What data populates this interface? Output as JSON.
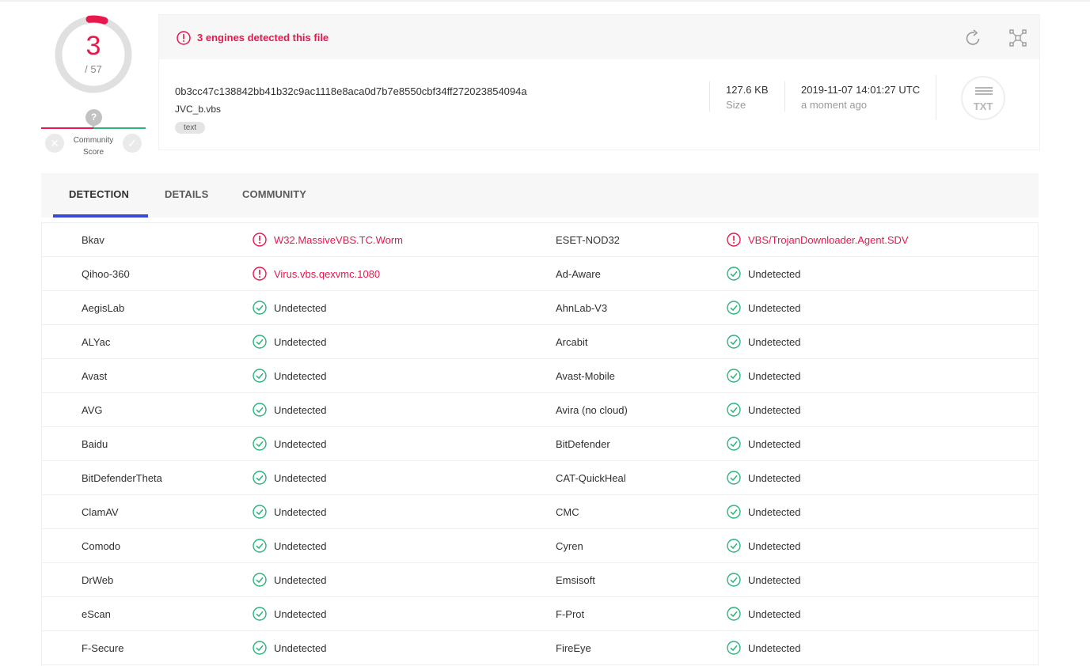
{
  "score": {
    "detected": "3",
    "total": "/ 57",
    "community_label_1": "Community",
    "community_label_2": "Score",
    "unknown_glyph": "?"
  },
  "file": {
    "alert_text": "3 engines detected this file",
    "hash": "0b3cc47c138842bb41b32c9ac1118e8aca0d7b7e8550cbf34ff272023854094a",
    "name": "JVC_b.vbs",
    "tag": "text",
    "size_value": "127.6 KB",
    "size_label": "Size",
    "date_value": "2019-11-07 14:01:27 UTC",
    "date_label": "a moment ago",
    "type_label": "TXT"
  },
  "tabs": [
    {
      "label": "DETECTION"
    },
    {
      "label": "DETAILS"
    },
    {
      "label": "COMMUNITY"
    }
  ],
  "colors": {
    "malicious": "#e8174c",
    "clean": "#2db37c",
    "tab_active": "#3a49d8"
  },
  "icons": {
    "alert": "exclamation-circle-icon",
    "clean": "check-circle-icon",
    "reload": "reload-icon",
    "graph": "graph-icon"
  },
  "detections": [
    {
      "left": {
        "engine": "Bkav",
        "result": "W32.MassiveVBS.TC.Worm",
        "status": "malicious"
      },
      "right": {
        "engine": "ESET-NOD32",
        "result": "VBS/TrojanDownloader.Agent.SDV",
        "status": "malicious"
      }
    },
    {
      "left": {
        "engine": "Qihoo-360",
        "result": "Virus.vbs.qexvmc.1080",
        "status": "malicious"
      },
      "right": {
        "engine": "Ad-Aware",
        "result": "Undetected",
        "status": "clean"
      }
    },
    {
      "left": {
        "engine": "AegisLab",
        "result": "Undetected",
        "status": "clean"
      },
      "right": {
        "engine": "AhnLab-V3",
        "result": "Undetected",
        "status": "clean"
      }
    },
    {
      "left": {
        "engine": "ALYac",
        "result": "Undetected",
        "status": "clean"
      },
      "right": {
        "engine": "Arcabit",
        "result": "Undetected",
        "status": "clean"
      }
    },
    {
      "left": {
        "engine": "Avast",
        "result": "Undetected",
        "status": "clean"
      },
      "right": {
        "engine": "Avast-Mobile",
        "result": "Undetected",
        "status": "clean"
      }
    },
    {
      "left": {
        "engine": "AVG",
        "result": "Undetected",
        "status": "clean"
      },
      "right": {
        "engine": "Avira (no cloud)",
        "result": "Undetected",
        "status": "clean"
      }
    },
    {
      "left": {
        "engine": "Baidu",
        "result": "Undetected",
        "status": "clean"
      },
      "right": {
        "engine": "BitDefender",
        "result": "Undetected",
        "status": "clean"
      }
    },
    {
      "left": {
        "engine": "BitDefenderTheta",
        "result": "Undetected",
        "status": "clean"
      },
      "right": {
        "engine": "CAT-QuickHeal",
        "result": "Undetected",
        "status": "clean"
      }
    },
    {
      "left": {
        "engine": "ClamAV",
        "result": "Undetected",
        "status": "clean"
      },
      "right": {
        "engine": "CMC",
        "result": "Undetected",
        "status": "clean"
      }
    },
    {
      "left": {
        "engine": "Comodo",
        "result": "Undetected",
        "status": "clean"
      },
      "right": {
        "engine": "Cyren",
        "result": "Undetected",
        "status": "clean"
      }
    },
    {
      "left": {
        "engine": "DrWeb",
        "result": "Undetected",
        "status": "clean"
      },
      "right": {
        "engine": "Emsisoft",
        "result": "Undetected",
        "status": "clean"
      }
    },
    {
      "left": {
        "engine": "eScan",
        "result": "Undetected",
        "status": "clean"
      },
      "right": {
        "engine": "F-Prot",
        "result": "Undetected",
        "status": "clean"
      }
    },
    {
      "left": {
        "engine": "F-Secure",
        "result": "Undetected",
        "status": "clean"
      },
      "right": {
        "engine": "FireEye",
        "result": "Undetected",
        "status": "clean"
      }
    }
  ]
}
